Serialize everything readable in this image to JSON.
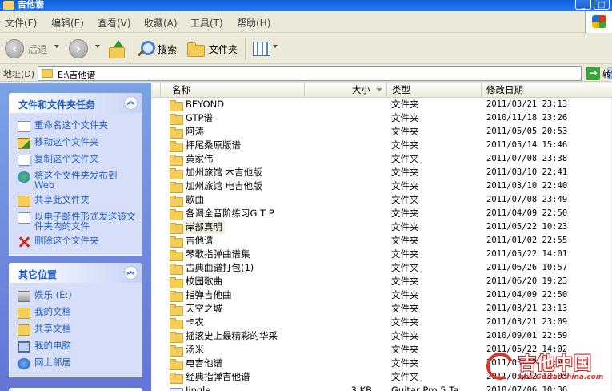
{
  "window": {
    "title": "吉他谱",
    "min_label": "_",
    "max_label": "□"
  },
  "menu": {
    "items": [
      "文件(F)",
      "编辑(E)",
      "查看(V)",
      "收藏(A)",
      "工具(T)",
      "帮助(H)"
    ]
  },
  "toolbar": {
    "back_label": "后退",
    "search_label": "搜索",
    "folders_label": "文件夹"
  },
  "address": {
    "label": "地址(D)",
    "value": "E:\\吉他谱",
    "go_label": "转"
  },
  "tasks_panel": {
    "title": "文件和文件夹任务",
    "items": [
      {
        "label": "重命名这个文件夹",
        "icon": "rename-icon"
      },
      {
        "label": "移动这个文件夹",
        "icon": "move-icon"
      },
      {
        "label": "复制这个文件夹",
        "icon": "copy-icon"
      },
      {
        "label": "将这个文件夹发布到 Web",
        "icon": "publish-web-icon"
      },
      {
        "label": "共享此文件夹",
        "icon": "share-icon"
      },
      {
        "label": "以电子邮件形式发送该文件夹内的文件",
        "icon": "email-icon"
      },
      {
        "label": "删除这个文件夹",
        "icon": "delete-icon"
      }
    ]
  },
  "places_panel": {
    "title": "其它位置",
    "items": [
      {
        "label": "娱乐 (E:)",
        "icon": "drive-icon"
      },
      {
        "label": "我的文档",
        "icon": "my-documents-icon"
      },
      {
        "label": "共享文档",
        "icon": "shared-documents-icon"
      },
      {
        "label": "我的电脑",
        "icon": "my-computer-icon"
      },
      {
        "label": "网上邻居",
        "icon": "network-icon"
      }
    ]
  },
  "columns": {
    "name": "名称",
    "size": "大小",
    "type": "类型",
    "date": "修改日期"
  },
  "files": [
    {
      "name": "BEYOND",
      "size": "",
      "type": "文件夹",
      "date": "2011/03/21 23:13"
    },
    {
      "name": "GTP谱",
      "size": "",
      "type": "文件夹",
      "date": "2010/11/18 23:26"
    },
    {
      "name": "阿涛",
      "size": "",
      "type": "文件夹",
      "date": "2011/05/05 20:53"
    },
    {
      "name": "押尾桑原版谱",
      "size": "",
      "type": "文件夹",
      "date": "2011/05/14 15:46"
    },
    {
      "name": "黄家伟",
      "size": "",
      "type": "文件夹",
      "date": "2011/07/08 23:38"
    },
    {
      "name": "加州旅馆 木吉他版",
      "size": "",
      "type": "文件夹",
      "date": "2011/03/10 22:41"
    },
    {
      "name": "加州旅馆 电吉他版",
      "size": "",
      "type": "文件夹",
      "date": "2011/03/10 22:40"
    },
    {
      "name": "歌曲",
      "size": "",
      "type": "文件夹",
      "date": "2011/07/08 23:49"
    },
    {
      "name": "各调全音阶练习G T P",
      "size": "",
      "type": "文件夹",
      "date": "2011/04/09 22:50"
    },
    {
      "name": "岸部真明",
      "size": "",
      "type": "文件夹",
      "date": "2011/05/22 10:23"
    },
    {
      "name": "吉他谱",
      "size": "",
      "type": "文件夹",
      "date": "2011/01/02 22:55"
    },
    {
      "name": "琴歌指弹曲谱集",
      "size": "",
      "type": "文件夹",
      "date": "2011/05/22 14:01"
    },
    {
      "name": "古典曲谱打包(1)",
      "size": "",
      "type": "文件夹",
      "date": "2011/06/26 10:57"
    },
    {
      "name": "校园歌曲",
      "size": "",
      "type": "文件夹",
      "date": "2011/06/20 19:23"
    },
    {
      "name": "指弹吉他曲",
      "size": "",
      "type": "文件夹",
      "date": "2011/04/09 22:50"
    },
    {
      "name": "天空之城",
      "size": "",
      "type": "文件夹",
      "date": "2011/03/21 23:13"
    },
    {
      "name": "卡农",
      "size": "",
      "type": "文件夹",
      "date": "2011/03/21 23:09"
    },
    {
      "name": "摇滚史上最精彩的华采",
      "size": "",
      "type": "文件夹",
      "date": "2010/09/01 22:59"
    },
    {
      "name": "汤米",
      "size": "",
      "type": "文件夹",
      "date": "2011/05/22 14:02"
    },
    {
      "name": "电吉他谱",
      "size": "",
      "type": "文件夹",
      "date": "2011/05/22 13:05"
    },
    {
      "name": "经典指弹吉他谱",
      "size": "",
      "type": "文件夹",
      "date": "2011/05/22 13:03"
    },
    {
      "name": "Jingle",
      "size": "3 KB",
      "type": "Guitar Pro 5 Ta",
      "date": "2010/07/06 10:36"
    }
  ],
  "watermark": {
    "text": "吉他中国",
    "url": "bbs.GuitarChina.com"
  },
  "colors": {
    "title_bar": "#0a5fd8",
    "task_pane": "#7ba2e7",
    "link": "#215dc6",
    "folder": "#f3cd5a"
  }
}
